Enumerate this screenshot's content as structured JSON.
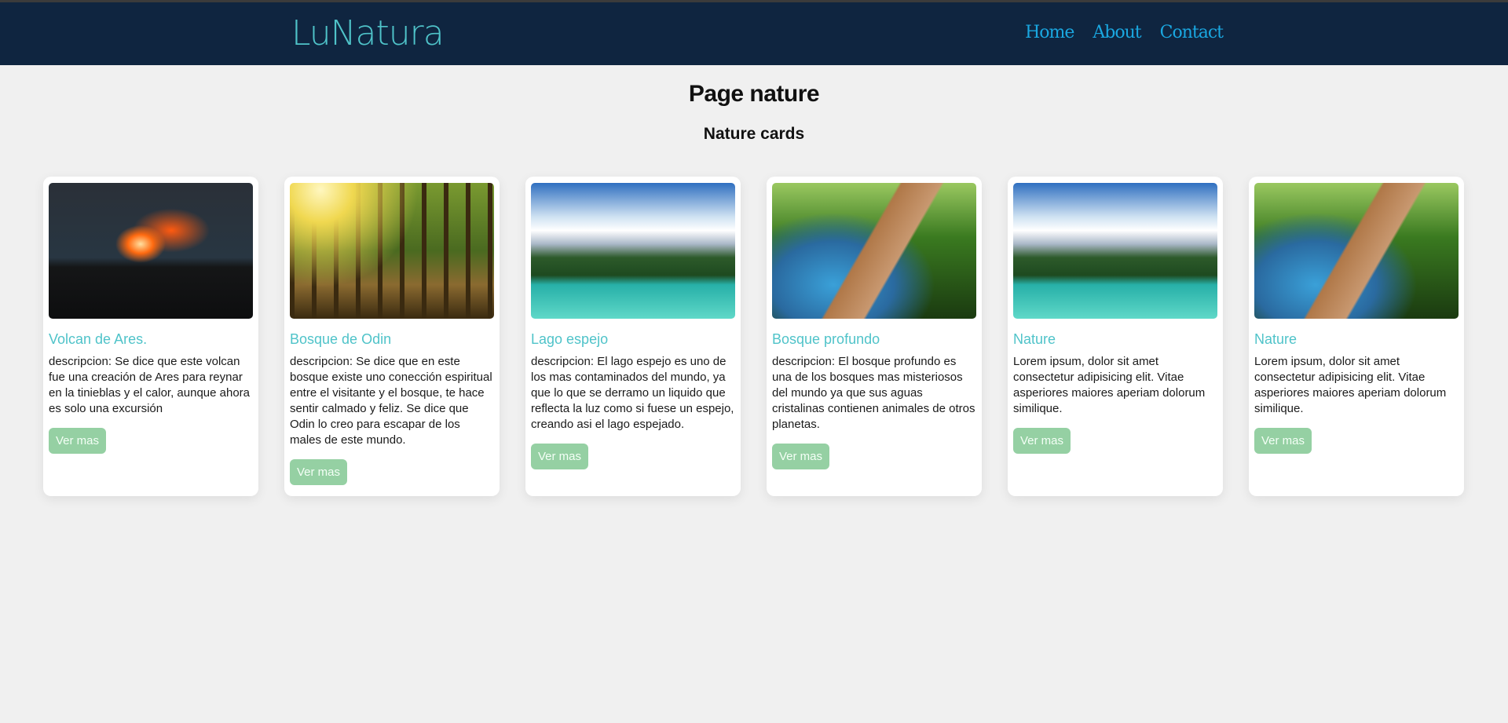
{
  "header": {
    "logo": "LuNatura",
    "nav": [
      "Home",
      "About",
      "Contact"
    ]
  },
  "page_title": "Page nature",
  "section_title": "Nature cards",
  "cards": [
    {
      "image": "volcano",
      "title": "Volcan de Ares.",
      "description": "descripcion: Se dice que este volcan fue una creación de Ares para reynar en la tinieblas y el calor, aunque ahora es solo una excursión",
      "button": "Ver mas"
    },
    {
      "image": "forest",
      "title": "Bosque de Odin",
      "description": "descripcion: Se dice que en este bosque existe uno conección espiritual entre el visitante y el bosque, te hace sentir calmado y feliz. Se dice que Odin lo creo para escapar de los males de este mundo.",
      "button": "Ver mas"
    },
    {
      "image": "lake",
      "title": "Lago espejo",
      "description": "descripcion: El lago espejo es uno de los mas contaminados del mundo, ya que lo que se derramo un liquido que reflecta la luz como si fuese un espejo, creando asi el lago espejado.",
      "button": "Ver mas"
    },
    {
      "image": "path",
      "title": "Bosque profundo",
      "description": "descripcion: El bosque profundo es una de los bosques mas misteriosos del mundo ya que sus aguas cristalinas contienen animales de otros planetas.",
      "button": "Ver mas"
    },
    {
      "image": "lake",
      "title": "Nature",
      "description": "Lorem ipsum, dolor sit amet consectetur adipisicing elit. Vitae asperiores maiores aperiam dolorum similique.",
      "button": "Ver mas"
    },
    {
      "image": "path",
      "title": "Nature",
      "description": "Lorem ipsum, dolor sit amet consectetur adipisicing elit. Vitae asperiores maiores aperiam dolorum similique.",
      "button": "Ver mas"
    }
  ]
}
